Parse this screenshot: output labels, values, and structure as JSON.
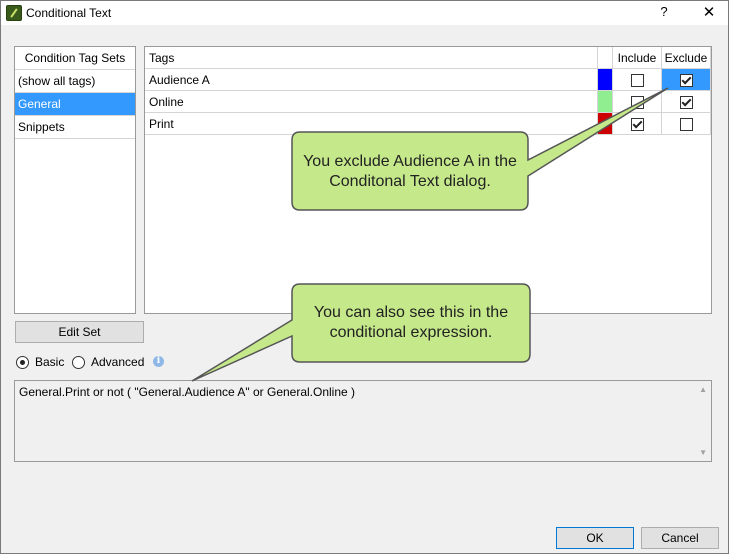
{
  "window": {
    "title": "Conditional Text",
    "help": "?",
    "close": "✕"
  },
  "tagsets": {
    "header": "Condition Tag Sets",
    "items": [
      {
        "label": "(show all tags)",
        "selected": false
      },
      {
        "label": "General",
        "selected": true
      },
      {
        "label": "Snippets",
        "selected": false
      }
    ]
  },
  "tags": {
    "headers": {
      "name": "Tags",
      "include": "Include",
      "exclude": "Exclude"
    },
    "rows": [
      {
        "name": "Audience A",
        "color": "#0000ff",
        "include": false,
        "exclude": true
      },
      {
        "name": "Online",
        "color": "#90ee90",
        "include": false,
        "exclude": true
      },
      {
        "name": "Print",
        "color": "#cc0000",
        "include": true,
        "exclude": false
      }
    ]
  },
  "edit_set_label": "Edit Set",
  "mode": {
    "basic": "Basic",
    "advanced": "Advanced",
    "selected": "basic"
  },
  "expression": "General.Print or not ( \"General.Audience A\" or General.Online )",
  "buttons": {
    "ok": "OK",
    "cancel": "Cancel"
  },
  "callouts": {
    "top": "You exclude Audience A in the Conditonal Text dialog.",
    "bottom": "You can also see this in the conditional expression."
  },
  "colors": {
    "selection": "#3399ff",
    "callout_fill": "#c5e88a"
  }
}
